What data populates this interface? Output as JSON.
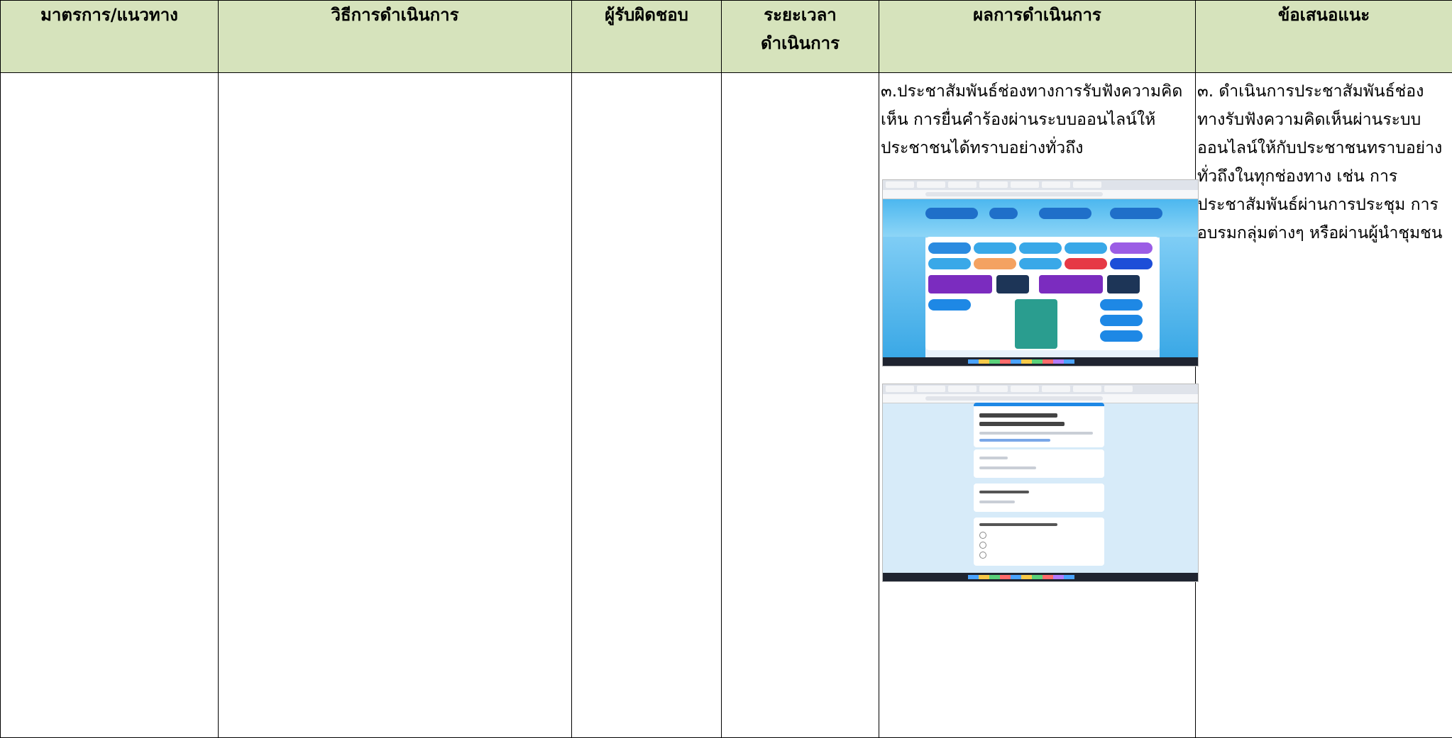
{
  "table": {
    "headers": [
      "มาตรการ/แนวทาง",
      "วิธีการดำเนินการ",
      "ผู้รับผิดชอบ",
      "ระยะเวลาดำเนินการ",
      "ผลการดำเนินการ",
      "ข้อเสนอแนะ"
    ],
    "header_period_line1": "ระยะเวลา",
    "header_period_line2": "ดำเนินการ",
    "row": {
      "measure": "",
      "method": "",
      "responsible": "",
      "period": "",
      "result": "๓.ประชาสัมพันธ์ช่องทางการรับฟังความคิดเห็น การยื่นคำร้องผ่านระบบออนไลน์ให้ประชาชนได้ทราบอย่างทั่วถึง",
      "suggestion": "๓. ดำเนินการประชาสัมพันธ์ช่องทางรับฟังความคิดเห็นผ่านระบบออนไลน์ให้กับประชาชนทราบอย่างทั่วถึงในทุกช่องทาง เช่น การประชาสัมพันธ์ผ่านการประชุม การอบรมกลุ่มต่างๆ หรือผ่านผู้นำชุมชน"
    }
  },
  "screenshots": [
    {
      "name": "website-screenshot"
    },
    {
      "name": "google-form-screenshot"
    }
  ]
}
